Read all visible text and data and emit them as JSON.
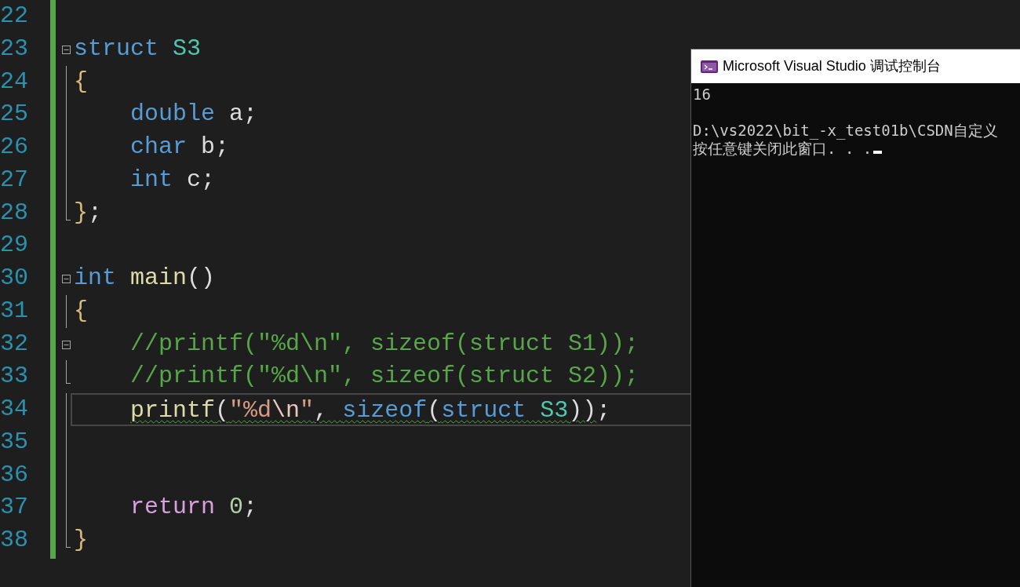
{
  "editor": {
    "lines": [
      {
        "number": "22",
        "kind": "plain",
        "current": false
      },
      {
        "number": "23",
        "kind": "start",
        "current": false,
        "tokens": [
          {
            "text": "struct ",
            "kind": "keyword",
            "squiggle": false
          },
          {
            "text": "S3",
            "kind": "type",
            "squiggle": false
          }
        ]
      },
      {
        "number": "24",
        "kind": "body",
        "current": false,
        "tokens": [
          {
            "text": "{",
            "kind": "brace",
            "squiggle": false
          }
        ]
      },
      {
        "number": "25",
        "kind": "body",
        "current": false,
        "tokens": [
          {
            "text": "    double",
            "kind": "keyword",
            "squiggle": false
          },
          {
            "text": " a;",
            "kind": "ident",
            "squiggle": false
          }
        ]
      },
      {
        "number": "26",
        "kind": "body",
        "current": false,
        "tokens": [
          {
            "text": "    char",
            "kind": "keyword",
            "squiggle": false
          },
          {
            "text": " b;",
            "kind": "ident",
            "squiggle": false
          }
        ]
      },
      {
        "number": "27",
        "kind": "body",
        "current": false,
        "tokens": [
          {
            "text": "    int",
            "kind": "keyword",
            "squiggle": false
          },
          {
            "text": " c;",
            "kind": "ident",
            "squiggle": false
          }
        ]
      },
      {
        "number": "28",
        "kind": "end",
        "current": false,
        "tokens": [
          {
            "text": "}",
            "kind": "brace",
            "squiggle": false
          },
          {
            "text": ";",
            "kind": "ident",
            "squiggle": false
          }
        ]
      },
      {
        "number": "29",
        "kind": "plain",
        "current": false
      },
      {
        "number": "30",
        "kind": "start",
        "current": false,
        "tokens": [
          {
            "text": "int ",
            "kind": "keyword",
            "squiggle": false
          },
          {
            "text": "main",
            "kind": "func",
            "squiggle": false
          },
          {
            "text": "()",
            "kind": "ident",
            "squiggle": false
          }
        ]
      },
      {
        "number": "31",
        "kind": "body",
        "current": false,
        "tokens": [
          {
            "text": "{",
            "kind": "brace",
            "squiggle": false
          }
        ]
      },
      {
        "number": "32",
        "kind": "start",
        "current": false,
        "tokens": [
          {
            "text": "    //printf(\"%d\\n\", sizeof(struct S1));",
            "kind": "comment",
            "squiggle": false
          }
        ]
      },
      {
        "number": "33",
        "kind": "end",
        "current": false,
        "tokens": [
          {
            "text": "    //printf(\"%d\\n\", sizeof(struct S2));",
            "kind": "comment",
            "squiggle": false
          }
        ]
      },
      {
        "number": "34",
        "kind": "body",
        "current": true,
        "tokens": [
          {
            "text": "    printf",
            "kind": "func",
            "squiggle": true
          },
          {
            "text": "(",
            "kind": "ident",
            "squiggle": true
          },
          {
            "text": "\"%d",
            "kind": "string",
            "squiggle": true
          },
          {
            "text": "\\n",
            "kind": "escape",
            "squiggle": true
          },
          {
            "text": "\"",
            "kind": "string",
            "squiggle": true
          },
          {
            "text": ", ",
            "kind": "ident",
            "squiggle": true
          },
          {
            "text": "sizeof",
            "kind": "keyword",
            "squiggle": true
          },
          {
            "text": "(",
            "kind": "ident",
            "squiggle": true
          },
          {
            "text": "struct ",
            "kind": "keyword",
            "squiggle": true
          },
          {
            "text": "S3",
            "kind": "type",
            "squiggle": true
          },
          {
            "text": "))",
            "kind": "ident",
            "squiggle": true
          },
          {
            "text": ";",
            "kind": "ident",
            "squiggle": false
          }
        ]
      },
      {
        "number": "35",
        "kind": "body",
        "current": false
      },
      {
        "number": "36",
        "kind": "body",
        "current": false
      },
      {
        "number": "37",
        "kind": "body",
        "current": false,
        "tokens": [
          {
            "text": "    return ",
            "kind": "control",
            "squiggle": false
          },
          {
            "text": "0",
            "kind": "number",
            "squiggle": false
          },
          {
            "text": ";",
            "kind": "ident",
            "squiggle": false
          }
        ]
      },
      {
        "number": "38",
        "kind": "end",
        "current": false,
        "tokens": [
          {
            "text": "}",
            "kind": "brace",
            "squiggle": false
          }
        ]
      }
    ]
  },
  "console": {
    "title": "Microsoft Visual Studio 调试控制台",
    "output": [
      {
        "text": "16",
        "blank_before": false,
        "cursor": false
      },
      {
        "text": "D:\\vs2022\\bit_-x_test01b\\CSDN自定义",
        "blank_before": true,
        "cursor": false
      },
      {
        "text": "按任意键关闭此窗口. . .",
        "blank_before": false,
        "cursor": true
      }
    ]
  }
}
